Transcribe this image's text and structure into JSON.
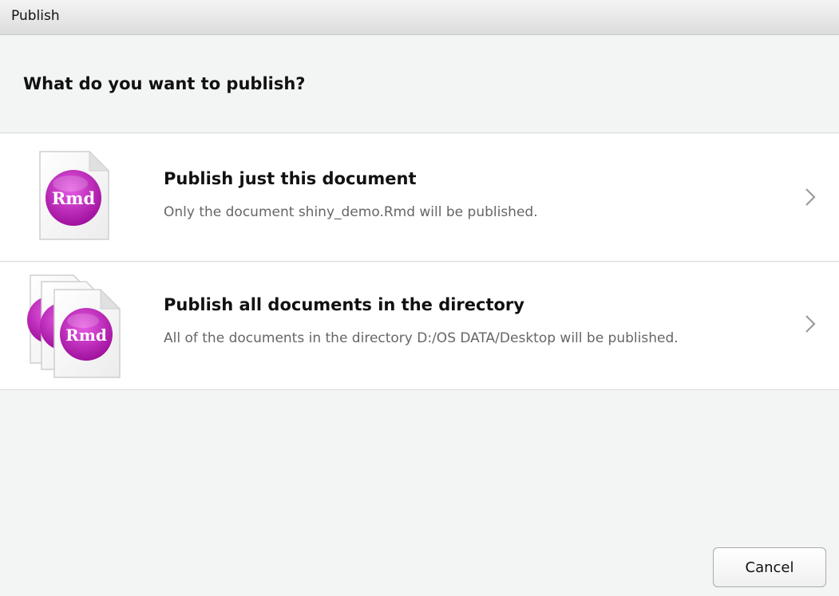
{
  "window": {
    "title": "Publish"
  },
  "header": {
    "heading": "What do you want to publish?"
  },
  "options": [
    {
      "icon": "rmd-document-icon",
      "icon_label": "Rmd",
      "title": "Publish just this document",
      "description": "Only the document shiny_demo.Rmd will be published."
    },
    {
      "icon": "rmd-documents-stack-icon",
      "icon_label": "Rmd",
      "title": "Publish all documents in the directory",
      "description": "All of the documents in the directory D:/OS DATA/Desktop will be published."
    }
  ],
  "footer": {
    "cancel_label": "Cancel"
  },
  "colors": {
    "rmd_badge": "#b21fb0",
    "rmd_badge_light": "#e65ce3",
    "description_text": "#666666",
    "panel_bg": "#f3f4f4"
  }
}
